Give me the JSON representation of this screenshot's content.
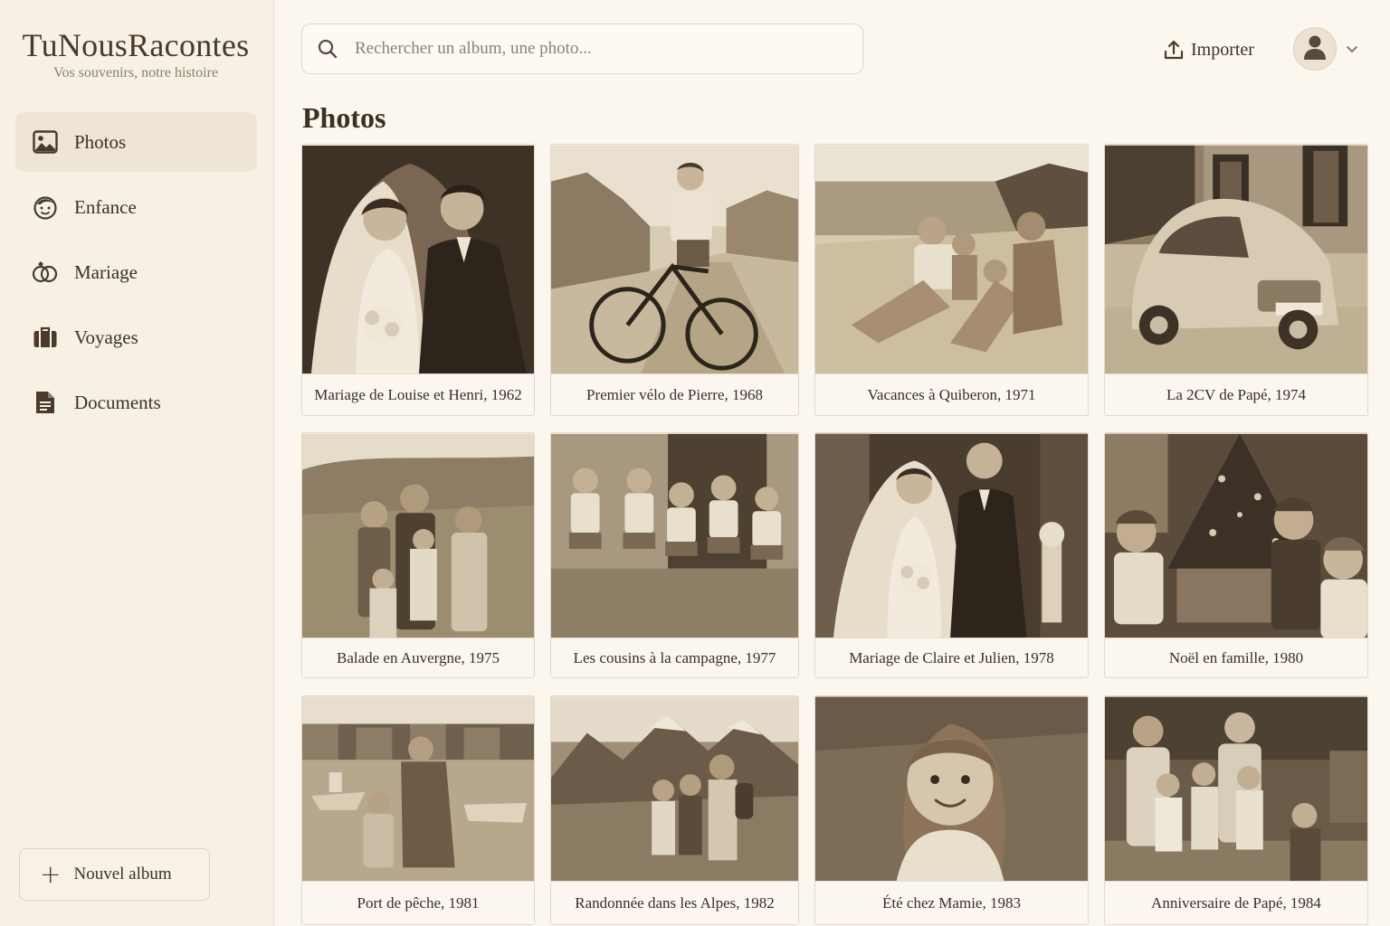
{
  "brand": {
    "title": "TuNousRacontes",
    "subtitle": "Vos souvenirs, notre histoire"
  },
  "sidebar": {
    "items": [
      {
        "label": "Photos",
        "icon": "image-icon",
        "active": true
      },
      {
        "label": "Enfance",
        "icon": "child-face-icon",
        "active": false
      },
      {
        "label": "Mariage",
        "icon": "rings-icon",
        "active": false
      },
      {
        "label": "Voyages",
        "icon": "suitcase-icon",
        "active": false
      },
      {
        "label": "Documents",
        "icon": "document-icon",
        "active": false
      }
    ],
    "new_album_label": "Nouvel album"
  },
  "header": {
    "search_placeholder": "Rechercher un album, une photo...",
    "import_label": "Importer"
  },
  "main": {
    "title": "Photos",
    "photos": [
      {
        "caption": "Mariage de Louise et Henri, 1962"
      },
      {
        "caption": "Premier vélo de Pierre, 1968"
      },
      {
        "caption": "Vacances à Quiberon, 1971"
      },
      {
        "caption": "La 2CV de Papé, 1974"
      },
      {
        "caption": "Balade en Auvergne, 1975"
      },
      {
        "caption": "Les cousins à la campagne, 1977"
      },
      {
        "caption": "Mariage de Claire et Julien, 1978"
      },
      {
        "caption": "Noël en famille, 1980"
      },
      {
        "caption": "Port de pêche, 1981"
      },
      {
        "caption": "Randonnée dans les Alpes, 1982"
      },
      {
        "caption": "Été chez Mamie, 1983"
      },
      {
        "caption": "Anniversaire de Papé, 1984"
      }
    ]
  },
  "colors": {
    "background": "#fbf6ee",
    "sidebar": "#f7f0e5",
    "active_item": "#efe5d6",
    "text": "#3a2f25",
    "sepia_dark": "#4a3a2b"
  }
}
